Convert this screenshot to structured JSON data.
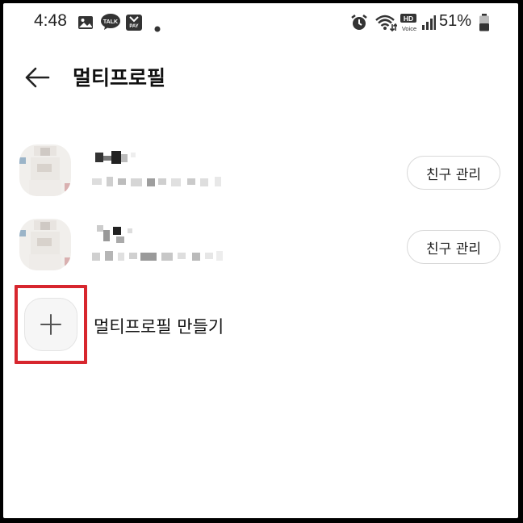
{
  "status_bar": {
    "time": "4:48",
    "left_icons": [
      "image-icon",
      "talk-icon",
      "pay-icon",
      "dot-icon"
    ],
    "right_icons": [
      "alarm-icon",
      "wifi-icon",
      "hd-voice-icon",
      "signal-icon",
      "battery-icon"
    ],
    "hd_label": "HD",
    "voice_label": "Voice",
    "talk_label": "TALK",
    "pay_label": "PAY",
    "battery": "51%"
  },
  "header": {
    "back_icon": "arrow-left-icon",
    "title": "멀티프로필"
  },
  "profiles": [
    {
      "button_label": "친구 관리"
    },
    {
      "button_label": "친구 관리"
    }
  ],
  "add_profile": {
    "icon": "plus-icon",
    "label": "멀티프로필 만들기"
  },
  "colors": {
    "highlight": "#d7262e",
    "background": "#ffffff"
  }
}
